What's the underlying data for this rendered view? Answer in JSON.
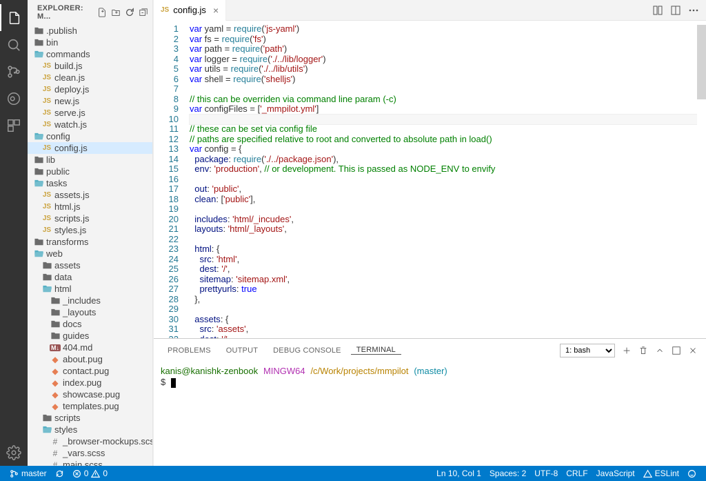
{
  "sidebar": {
    "title": "EXPLORER: M...",
    "tree": [
      {
        "d": 0,
        "t": "folder",
        "name": ".publish"
      },
      {
        "d": 0,
        "t": "folder",
        "name": "bin"
      },
      {
        "d": 0,
        "t": "folder-open",
        "name": "commands"
      },
      {
        "d": 1,
        "t": "js",
        "name": "build.js"
      },
      {
        "d": 1,
        "t": "js",
        "name": "clean.js"
      },
      {
        "d": 1,
        "t": "js",
        "name": "deploy.js"
      },
      {
        "d": 1,
        "t": "js",
        "name": "new.js"
      },
      {
        "d": 1,
        "t": "js",
        "name": "serve.js"
      },
      {
        "d": 1,
        "t": "js",
        "name": "watch.js"
      },
      {
        "d": 0,
        "t": "folder-open",
        "name": "config"
      },
      {
        "d": 1,
        "t": "js",
        "name": "config.js",
        "selected": true
      },
      {
        "d": 0,
        "t": "folder",
        "name": "lib"
      },
      {
        "d": 0,
        "t": "folder",
        "name": "public"
      },
      {
        "d": 0,
        "t": "folder-open",
        "name": "tasks"
      },
      {
        "d": 1,
        "t": "js",
        "name": "assets.js"
      },
      {
        "d": 1,
        "t": "js",
        "name": "html.js"
      },
      {
        "d": 1,
        "t": "js",
        "name": "scripts.js"
      },
      {
        "d": 1,
        "t": "js",
        "name": "styles.js"
      },
      {
        "d": 0,
        "t": "folder",
        "name": "transforms"
      },
      {
        "d": 0,
        "t": "folder-open",
        "name": "web"
      },
      {
        "d": 1,
        "t": "folder",
        "name": "assets"
      },
      {
        "d": 1,
        "t": "folder",
        "name": "data"
      },
      {
        "d": 1,
        "t": "folder-open",
        "name": "html"
      },
      {
        "d": 2,
        "t": "folder",
        "name": "_includes"
      },
      {
        "d": 2,
        "t": "folder",
        "name": "_layouts"
      },
      {
        "d": 2,
        "t": "folder",
        "name": "docs"
      },
      {
        "d": 2,
        "t": "folder",
        "name": "guides"
      },
      {
        "d": 2,
        "t": "md",
        "name": "404.md"
      },
      {
        "d": 2,
        "t": "pug",
        "name": "about.pug"
      },
      {
        "d": 2,
        "t": "pug",
        "name": "contact.pug"
      },
      {
        "d": 2,
        "t": "pug",
        "name": "index.pug"
      },
      {
        "d": 2,
        "t": "pug",
        "name": "showcase.pug"
      },
      {
        "d": 2,
        "t": "pug",
        "name": "templates.pug"
      },
      {
        "d": 1,
        "t": "folder",
        "name": "scripts"
      },
      {
        "d": 1,
        "t": "folder-open",
        "name": "styles"
      },
      {
        "d": 2,
        "t": "scss",
        "name": "_browser-mockups.scss"
      },
      {
        "d": 2,
        "t": "scss",
        "name": "_vars.scss"
      },
      {
        "d": 2,
        "t": "scss",
        "name": "main.scss"
      }
    ]
  },
  "tabs": [
    {
      "icon": "js",
      "name": "config.js"
    }
  ],
  "code": {
    "lines": [
      [
        [
          "kw",
          "var"
        ],
        [
          "",
          " yaml = "
        ],
        [
          "fn",
          "require"
        ],
        [
          "",
          "("
        ],
        [
          "str",
          "'js-yaml'"
        ],
        [
          "",
          ")"
        ]
      ],
      [
        [
          "kw",
          "var"
        ],
        [
          "",
          " fs = "
        ],
        [
          "fn",
          "require"
        ],
        [
          "",
          "("
        ],
        [
          "str",
          "'fs'"
        ],
        [
          "",
          ")"
        ]
      ],
      [
        [
          "kw",
          "var"
        ],
        [
          "",
          " path = "
        ],
        [
          "fn",
          "require"
        ],
        [
          "",
          "("
        ],
        [
          "str",
          "'path'"
        ],
        [
          "",
          ")"
        ]
      ],
      [
        [
          "kw",
          "var"
        ],
        [
          "",
          " logger = "
        ],
        [
          "fn",
          "require"
        ],
        [
          "",
          "("
        ],
        [
          "str",
          "'./../lib/logger'"
        ],
        [
          "",
          ")"
        ]
      ],
      [
        [
          "kw",
          "var"
        ],
        [
          "",
          " utils = "
        ],
        [
          "fn",
          "require"
        ],
        [
          "",
          "("
        ],
        [
          "str",
          "'./../lib/utils'"
        ],
        [
          "",
          ")"
        ]
      ],
      [
        [
          "kw",
          "var"
        ],
        [
          "",
          " shell = "
        ],
        [
          "fn",
          "require"
        ],
        [
          "",
          "("
        ],
        [
          "str",
          "'shelljs'"
        ],
        [
          "",
          ")"
        ]
      ],
      [
        [
          "",
          ""
        ]
      ],
      [
        [
          "cmt",
          "// this can be overriden via command line param (-c)"
        ]
      ],
      [
        [
          "kw",
          "var"
        ],
        [
          "",
          " configFiles = ["
        ],
        [
          "str",
          "'_mmpilot.yml'"
        ],
        [
          "",
          "]"
        ]
      ],
      [
        [
          "",
          ""
        ]
      ],
      [
        [
          "cmt",
          "// these can be set via config file"
        ]
      ],
      [
        [
          "cmt",
          "// paths are specified relative to root and converted to absolute path in load()"
        ]
      ],
      [
        [
          "kw",
          "var"
        ],
        [
          "",
          " config = {"
        ]
      ],
      [
        [
          "",
          "  "
        ],
        [
          "prop",
          "package"
        ],
        [
          "",
          ": "
        ],
        [
          "fn",
          "require"
        ],
        [
          "",
          "("
        ],
        [
          "str",
          "'./../package.json'"
        ],
        [
          "",
          "),"
        ]
      ],
      [
        [
          "",
          "  "
        ],
        [
          "prop",
          "env"
        ],
        [
          "",
          ": "
        ],
        [
          "str",
          "'production'"
        ],
        [
          "",
          ", "
        ],
        [
          "cmt",
          "// or development. This is passed as NODE_ENV to envify"
        ]
      ],
      [
        [
          "",
          ""
        ]
      ],
      [
        [
          "",
          "  "
        ],
        [
          "prop",
          "out"
        ],
        [
          "",
          ": "
        ],
        [
          "str",
          "'public'"
        ],
        [
          "",
          ","
        ]
      ],
      [
        [
          "",
          "  "
        ],
        [
          "prop",
          "clean"
        ],
        [
          "",
          ": ["
        ],
        [
          "str",
          "'public'"
        ],
        [
          "",
          "],"
        ]
      ],
      [
        [
          "",
          ""
        ]
      ],
      [
        [
          "",
          "  "
        ],
        [
          "prop",
          "includes"
        ],
        [
          "",
          ": "
        ],
        [
          "str",
          "'html/_incudes'"
        ],
        [
          "",
          ","
        ]
      ],
      [
        [
          "",
          "  "
        ],
        [
          "prop",
          "layouts"
        ],
        [
          "",
          ": "
        ],
        [
          "str",
          "'html/_layouts'"
        ],
        [
          "",
          ","
        ]
      ],
      [
        [
          "",
          ""
        ]
      ],
      [
        [
          "",
          "  "
        ],
        [
          "prop",
          "html"
        ],
        [
          "",
          ": {"
        ]
      ],
      [
        [
          "",
          "    "
        ],
        [
          "prop",
          "src"
        ],
        [
          "",
          ": "
        ],
        [
          "str",
          "'html'"
        ],
        [
          "",
          ","
        ]
      ],
      [
        [
          "",
          "    "
        ],
        [
          "prop",
          "dest"
        ],
        [
          "",
          ": "
        ],
        [
          "str",
          "'/'"
        ],
        [
          "",
          ","
        ]
      ],
      [
        [
          "",
          "    "
        ],
        [
          "prop",
          "sitemap"
        ],
        [
          "",
          ": "
        ],
        [
          "str",
          "'sitemap.xml'"
        ],
        [
          "",
          ","
        ]
      ],
      [
        [
          "",
          "    "
        ],
        [
          "prop",
          "prettyurls"
        ],
        [
          "",
          ": "
        ],
        [
          "bool",
          "true"
        ]
      ],
      [
        [
          "",
          "  },"
        ]
      ],
      [
        [
          "",
          ""
        ]
      ],
      [
        [
          "",
          "  "
        ],
        [
          "prop",
          "assets"
        ],
        [
          "",
          ": {"
        ]
      ],
      [
        [
          "",
          "    "
        ],
        [
          "prop",
          "src"
        ],
        [
          "",
          ": "
        ],
        [
          "str",
          "'assets'"
        ],
        [
          "",
          ","
        ]
      ],
      [
        [
          "",
          "    "
        ],
        [
          "prop",
          "dest"
        ],
        [
          "",
          ": "
        ],
        [
          "str",
          "'/'"
        ]
      ]
    ],
    "currentLine": 10
  },
  "panel": {
    "tabs": [
      "PROBLEMS",
      "OUTPUT",
      "DEBUG CONSOLE",
      "TERMINAL"
    ],
    "active": "TERMINAL",
    "shell": "1: bash",
    "terminal": {
      "user": "kanis@kanishk-zenbook",
      "sys": "MINGW64",
      "path": "/c/Work/projects/mmpilot",
      "branch": "(master)",
      "prompt": "$"
    }
  },
  "status": {
    "branch": "master",
    "errors": "0",
    "warnings": "0",
    "lncol": "Ln 10, Col 1",
    "spaces": "Spaces: 2",
    "encoding": "UTF-8",
    "eol": "CRLF",
    "lang": "JavaScript",
    "eslint": "ESLint"
  }
}
